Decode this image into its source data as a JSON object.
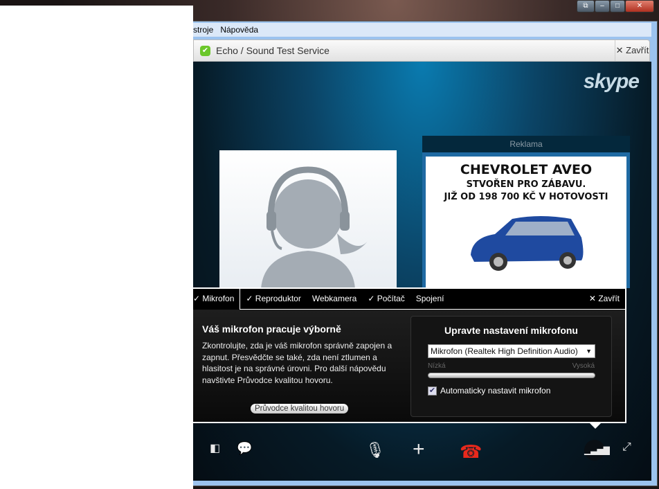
{
  "window": {
    "controls": [
      "restore",
      "minimize",
      "maximize",
      "close"
    ]
  },
  "menu": {
    "items": [
      "stroje",
      "Nápověda"
    ]
  },
  "tab": {
    "title": "Echo / Sound Test Service",
    "close_label": "Zavřít",
    "status_icon": "check-online-icon"
  },
  "brand": "skype",
  "ad": {
    "header": "Reklama",
    "line1": "CHEVROLET AVEO",
    "line2": "STVOŘEN PRO ZÁBAVU.",
    "line3": "JIŽ OD 198 700 KČ V HOTOVOSTI"
  },
  "panel": {
    "tabs": [
      {
        "label": "Mikrofon",
        "checked": true,
        "active": true
      },
      {
        "label": "Reproduktor",
        "checked": true
      },
      {
        "label": "Webkamera",
        "checked": false
      },
      {
        "label": "Počítač",
        "checked": true
      },
      {
        "label": "Spojení",
        "checked": false
      }
    ],
    "close_label": "Zavřít",
    "heading": "Váš mikrofon pracuje výborně",
    "text": "Zkontrolujte, zda je váš mikrofon správně zapojen a zapnut. Přesvědčte se také, zda není ztlumen a hlasitost je na správné úrovni. Pro další nápovědu navštivte Průvodce kvalitou hovoru.",
    "guide_button": "Průvodce kvalitou hovoru",
    "settings": {
      "title": "Upravte nastavení mikrofonu",
      "device": "Mikrofon (Realtek High Definition Audio)",
      "low_label": "Nízká",
      "high_label": "Vysoká",
      "level_percent": 100,
      "auto_label": "Automaticky nastavit mikrofon",
      "auto_checked": true
    }
  },
  "controls": [
    "share-screen",
    "chat",
    "microphone",
    "add",
    "hang-up",
    "signal-quality",
    "fullscreen"
  ],
  "colors": {
    "hangup": "#e8291c",
    "online": "#6bc72a"
  }
}
